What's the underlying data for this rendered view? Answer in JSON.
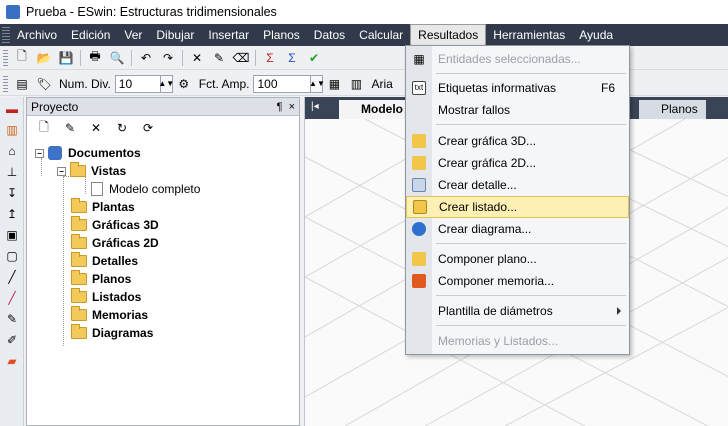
{
  "window": {
    "title": "Prueba - ESwin: Estructuras tridimensionales"
  },
  "menu": [
    {
      "label": "Archivo"
    },
    {
      "label": "Edición"
    },
    {
      "label": "Ver"
    },
    {
      "label": "Dibujar"
    },
    {
      "label": "Insertar"
    },
    {
      "label": "Planos"
    },
    {
      "label": "Datos"
    },
    {
      "label": "Calcular"
    },
    {
      "label": "Resultados"
    },
    {
      "label": "Herramientas"
    },
    {
      "label": "Ayuda"
    }
  ],
  "toolbar2": {
    "num_div_label": "Num. Div.",
    "num_div_value": "10",
    "fct_amp_label": "Fct. Amp.",
    "fct_amp_value": "100",
    "font_label": "Aria"
  },
  "project_panel": {
    "title": "Proyecto",
    "pin": "¶",
    "close": "×"
  },
  "tree": {
    "root": "Documentos",
    "vistas": "Vistas",
    "modelo": "Modelo completo",
    "plantas": "Plantas",
    "graficas3d": "Gráficas 3D",
    "graficas2d": "Gráficas 2D",
    "detalles": "Detalles",
    "planos": "Planos",
    "listados": "Listados",
    "memorias": "Memorias",
    "diagramas": "Diagramas"
  },
  "tabs": {
    "modelo": "Modelo",
    "planos": "Planos"
  },
  "dropdown": {
    "entidades": "Entidades seleccionadas...",
    "etiquetas": "Etiquetas informativas",
    "etiquetas_shortcut": "F6",
    "mostrar": "Mostrar fallos",
    "grafica3d": "Crear gráfica 3D...",
    "grafica2d": "Crear gráfica 2D...",
    "detalle": "Crear detalle...",
    "listado": "Crear listado...",
    "diagrama": "Crear diagrama...",
    "plano": "Componer plano...",
    "memoria": "Componer memoria...",
    "plantilla": "Plantilla de diámetros",
    "memorias_listados": "Memorias y Listados..."
  },
  "colors": {
    "menubar": "#303a4a",
    "highlight": "#fdf0b5",
    "folder": "#f3c95a"
  }
}
